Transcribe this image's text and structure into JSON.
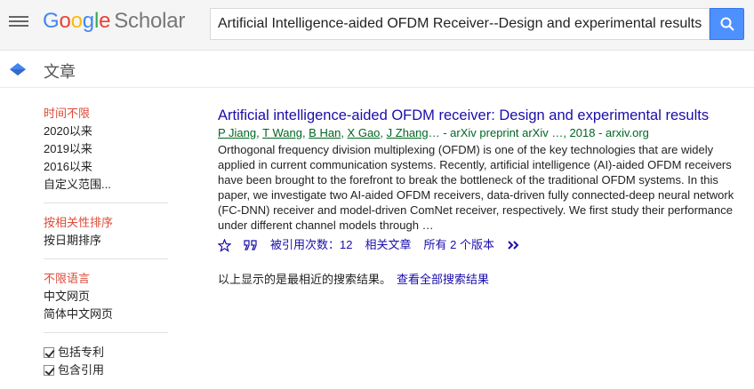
{
  "header": {
    "logo_google": [
      "G",
      "o",
      "o",
      "g",
      "l",
      "e"
    ],
    "logo_scholar": "Scholar",
    "search_query": "Artificial Intelligence-aided OFDM Receiver--Design and experimental results"
  },
  "subbar": {
    "title": "文章"
  },
  "sidebar": {
    "time": [
      "时间不限",
      "2020以来",
      "2019以来",
      "2016以来",
      "自定义范围..."
    ],
    "sort": [
      "按相关性排序",
      "按日期排序"
    ],
    "language": [
      "不限语言",
      "中文网页",
      "简体中文网页"
    ],
    "checks": [
      "包括专利",
      "包含引用"
    ]
  },
  "result": {
    "title": "Artificial intelligence-aided OFDM receiver: Design and experimental results",
    "authors": [
      "P Jiang",
      "T Wang",
      "B Han",
      "X Gao",
      "J Zhang"
    ],
    "author_rest": "… - arXiv preprint arXiv …, 2018 - arxiv.org",
    "snippet": "Orthogonal frequency division multiplexing (OFDM) is one of the key technologies that are widely applied in current communication systems. Recently, artificial intelligence (AI)-aided OFDM receivers have been brought to the forefront to break the bottleneck of the traditional OFDM systems. In this paper, we investigate two AI-aided OFDM receivers, data-driven fully connected-deep neural network (FC-DNN) receiver and model-driven ComNet receiver, respectively. We first study their performance under different channel models through …",
    "cited_by": "被引用次数：12",
    "related": "相关文章",
    "versions": "所有 2 个版本"
  },
  "note": {
    "text": "以上显示的是最相近的搜索结果。",
    "link": "查看全部搜索结果"
  },
  "colors": {
    "accent_blue": "#4d90fe",
    "link": "#1a0dab",
    "active": "#dd4b39",
    "green": "#006621"
  }
}
